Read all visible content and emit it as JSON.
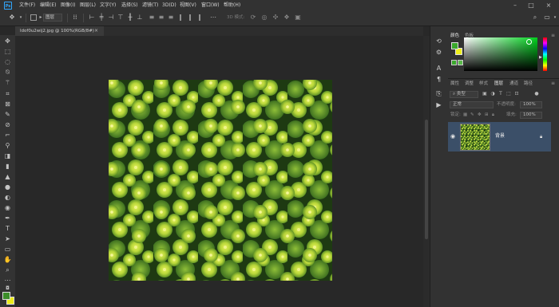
{
  "app": {
    "logo_text": "Ps"
  },
  "menu": [
    "文件(F)",
    "编辑(E)",
    "图像(I)",
    "图层(L)",
    "文字(Y)",
    "选择(S)",
    "滤镜(T)",
    "3D(D)",
    "视图(V)",
    "窗口(W)",
    "帮助(H)"
  ],
  "window_controls": {
    "minimize": "–",
    "maximize": "□",
    "close": "×"
  },
  "options_bar": {
    "layer_select": "图层",
    "mode_3d": "3D 模式:"
  },
  "document": {
    "tab_title": "ldof0u2wij2.jpg @ 100%(RGB/8#)",
    "close_glyph": "×"
  },
  "color_panel": {
    "tabs": [
      "颜色",
      "色板"
    ],
    "foreground": "#3aa82c",
    "background": "#efef1c"
  },
  "layers_panel": {
    "tabs": [
      "属性",
      "调整",
      "样式",
      "图层",
      "通道",
      "路径"
    ],
    "active_tab": "图层",
    "search_kind": "类型",
    "blend_mode": "正常",
    "opacity_label": "不透明度:",
    "opacity_value": "100%",
    "lock_label": "锁定:",
    "fill_label": "填充:",
    "fill_value": "100%",
    "layers": [
      {
        "name": "背景",
        "visible": true,
        "locked": true
      }
    ]
  },
  "icons": {
    "tools": [
      "move-icon",
      "marquee-icon",
      "lasso-icon",
      "quick-select-icon",
      "crop-icon",
      "eyedropper-icon",
      "healing-brush-icon",
      "brush-icon",
      "clone-stamp-icon",
      "history-brush-icon",
      "eraser-icon",
      "gradient-icon",
      "blur-icon",
      "dodge-icon",
      "pen-icon",
      "type-icon",
      "path-select-icon",
      "shape-icon",
      "hand-icon",
      "zoom-icon",
      "more-icon"
    ],
    "strip": [
      "history-icon",
      "adjust-icon",
      "character-icon",
      "paragraph-icon",
      "glyphs-icon",
      "actions-icon"
    ]
  }
}
